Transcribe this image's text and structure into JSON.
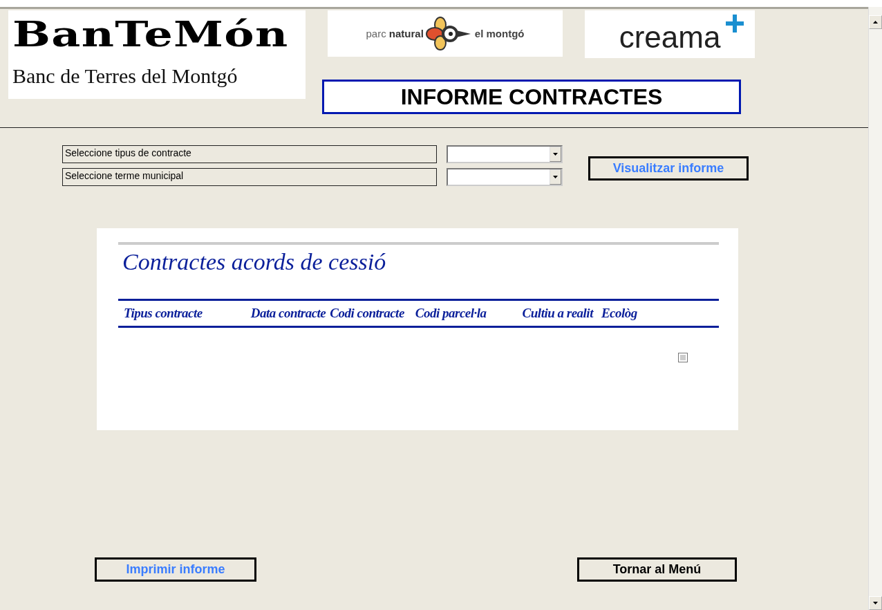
{
  "header": {
    "logo": "BanTeMón",
    "subtitle": "Banc de Terres del Montgó",
    "partner_logo": {
      "prefix": "parc",
      "name": "natural",
      "suffix": "el montgó"
    },
    "sponsor_logo": "creama",
    "title": "INFORME CONTRACTES"
  },
  "filters": [
    {
      "label": "Seleccione tipus de contracte"
    },
    {
      "label": "Seleccione terme municipal"
    }
  ],
  "view_button": "Visualitzar informe",
  "report": {
    "title": "Contractes acords de cessió",
    "columns": [
      "Tipus contracte",
      "Data contracte",
      "Codi contracte",
      "Codi parcel·la",
      "Cultiu a realit",
      "Ecològ"
    ],
    "checkbox": {
      "checked": false
    }
  },
  "buttons": [
    {
      "label": "Imprimir informe",
      "kind": "link"
    },
    {
      "label": "Tornar al Menú",
      "kind": "plain"
    }
  ]
}
